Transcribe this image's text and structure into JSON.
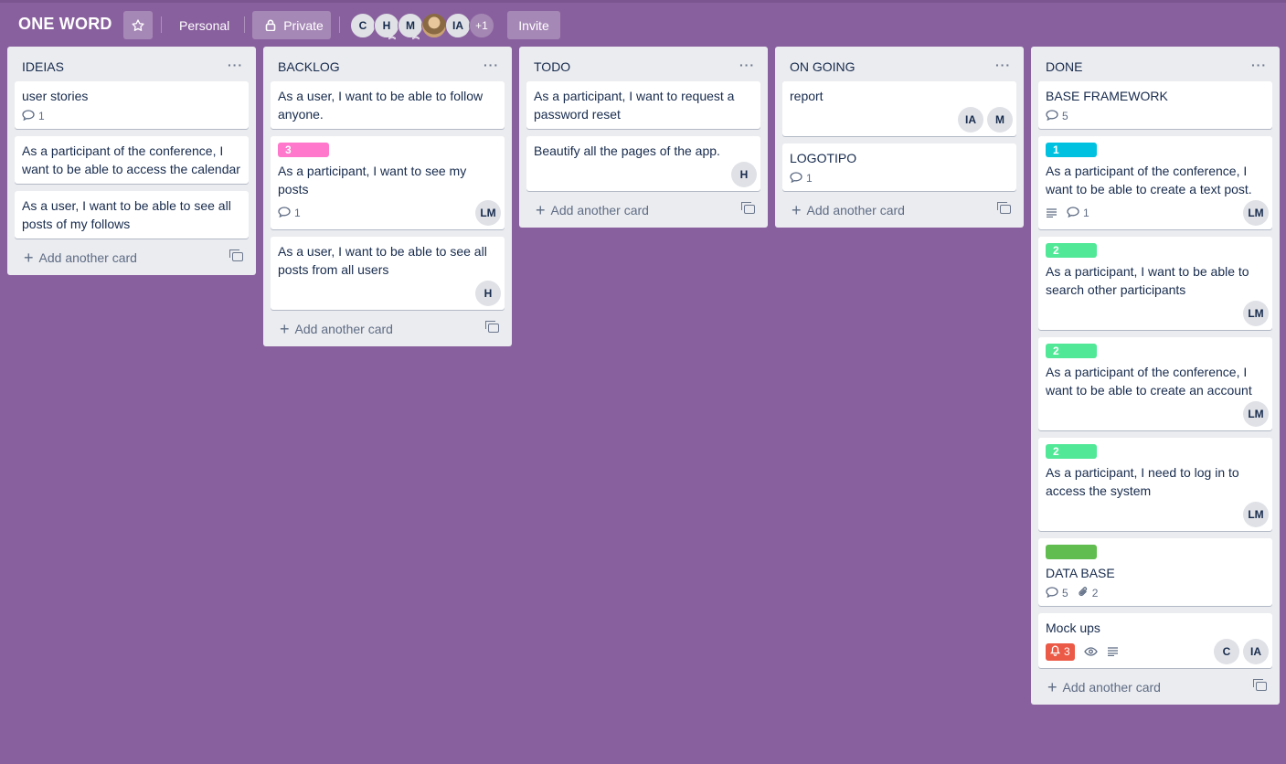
{
  "board": {
    "title": "ONE WORD",
    "team_label": "Personal",
    "visibility_label": "Private",
    "invite_label": "Invite",
    "members": [
      "C",
      "H",
      "M",
      "",
      "IA"
    ],
    "more_members": "+1",
    "background": "#89609e"
  },
  "list_footer": {
    "add_label": "Add another card"
  },
  "lists": [
    {
      "title": "IDEIAS",
      "cards": [
        {
          "text": "user stories",
          "comments": "1"
        },
        {
          "text": "As a participant of the conference, I want to be able to access the calendar"
        },
        {
          "text": "As a user, I want to be able to see all posts of my follows"
        }
      ]
    },
    {
      "title": "BACKLOG",
      "cards": [
        {
          "text": "As a user, I want to be able to follow anyone."
        },
        {
          "label": "3",
          "label_color": "#ff78cb",
          "text": "As a participant, I want to see my posts",
          "comments": "1",
          "members": [
            "LM"
          ]
        },
        {
          "text": "As a user, I want to be able to see all posts from all users",
          "members": [
            "H"
          ]
        }
      ]
    },
    {
      "title": "TODO",
      "cards": [
        {
          "text": "As a participant, I want to request a password reset"
        },
        {
          "text": "Beautify all the pages of the app.",
          "members": [
            "H"
          ]
        }
      ]
    },
    {
      "title": "ON GOING",
      "cards": [
        {
          "text": "report",
          "members": [
            "IA",
            "M"
          ]
        },
        {
          "text": "LOGOTIPO",
          "comments": "1"
        }
      ]
    },
    {
      "title": "DONE",
      "cards": [
        {
          "text": "BASE FRAMEWORK",
          "comments": "5"
        },
        {
          "label": "1",
          "label_color": "#00c2e0",
          "text": "As a participant of the conference, I want to be able to create a text post.",
          "comments": "1",
          "members": [
            "LM"
          ]
        },
        {
          "label": "2",
          "label_color": "#51e898",
          "text": "As a participant, I want to be able to search other participants",
          "members": [
            "LM"
          ]
        },
        {
          "label": "2",
          "label_color": "#51e898",
          "text": "As a participant of the conference, I want to be able to create an account",
          "members": [
            "LM"
          ]
        },
        {
          "label": "2",
          "label_color": "#51e898",
          "text": "As a participant, I need to log in to access the system",
          "members": [
            "LM"
          ]
        },
        {
          "label": "",
          "label_color": "#61bd4f",
          "text": "DATA BASE",
          "comments": "5",
          "attachments": "2"
        },
        {
          "text": "Mock ups",
          "notifications": "3",
          "members": [
            "C",
            "IA"
          ]
        }
      ]
    }
  ]
}
